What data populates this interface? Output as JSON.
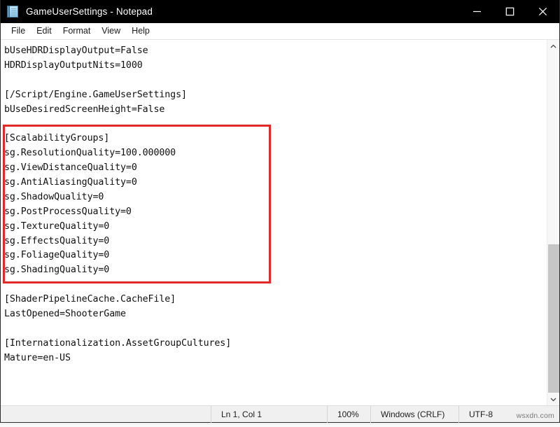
{
  "window": {
    "title": "GameUserSettings - Notepad",
    "icon": "notepad-icon",
    "controls": {
      "minimize": "minimize-icon",
      "maximize": "maximize-icon",
      "close": "close-icon"
    }
  },
  "menubar": {
    "items": [
      {
        "label": "File"
      },
      {
        "label": "Edit"
      },
      {
        "label": "Format"
      },
      {
        "label": "View"
      },
      {
        "label": "Help"
      }
    ]
  },
  "document": {
    "lines": [
      "bUseHDRDisplayOutput=False",
      "HDRDisplayOutputNits=1000",
      "",
      "[/Script/Engine.GameUserSettings]",
      "bUseDesiredScreenHeight=False",
      "",
      "[ScalabilityGroups]",
      "sg.ResolutionQuality=100.000000",
      "sg.ViewDistanceQuality=0",
      "sg.AntiAliasingQuality=0",
      "sg.ShadowQuality=0",
      "sg.PostProcessQuality=0",
      "sg.TextureQuality=0",
      "sg.EffectsQuality=0",
      "sg.FoliageQuality=0",
      "sg.ShadingQuality=0",
      "",
      "[ShaderPipelineCache.CacheFile]",
      "LastOpened=ShooterGame",
      "",
      "[Internationalization.AssetGroupCultures]",
      "Mature=en-US"
    ]
  },
  "annotation": {
    "color": "#e02a2a",
    "covers_section": "[ScalabilityGroups]"
  },
  "scrollbar": {
    "up_arrow": "chevron-up-icon",
    "down_arrow": "chevron-down-icon"
  },
  "statusbar": {
    "position": "Ln 1, Col 1",
    "zoom": "100%",
    "line_endings": "Windows (CRLF)",
    "encoding": "UTF-8"
  },
  "watermark": {
    "text": "wsxdn.com"
  }
}
